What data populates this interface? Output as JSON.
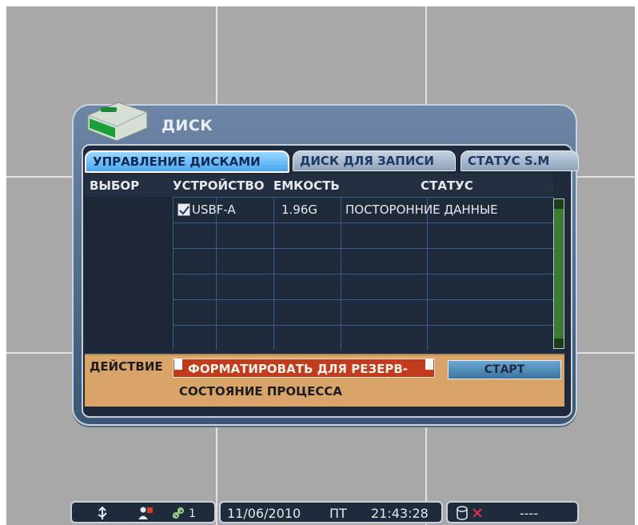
{
  "dialog": {
    "title": "ДИСК"
  },
  "tabs": [
    {
      "label": "УПРАВЛЕНИЕ ДИСКАМИ",
      "active": true
    },
    {
      "label": "ДИСК ДЛЯ ЗАПИСИ",
      "active": false
    },
    {
      "label": "СТАТУС  S.M",
      "active": false
    }
  ],
  "table": {
    "headers": [
      "ВЫБОР",
      "УСТРОЙСТВО",
      "ЕМКОСТЬ",
      "СТАТУС"
    ],
    "rows": [
      {
        "checked": true,
        "device": "USBF-A",
        "capacity": "1.96G",
        "status": "ПОСТОРОННИЕ ДАННЫЕ"
      }
    ]
  },
  "action": {
    "label": "ДЕЙСТВИЕ",
    "selected": "ФОРМАТИРОВАТЬ ДЛЯ РЕЗЕРВ-",
    "start_button": "СТАРТ",
    "process_label": "СОСТОЯНИЕ ПРОЦЕССА"
  },
  "statusbar": {
    "date": "11/06/2010",
    "weekday": "ПТ",
    "time": "21:43:28",
    "channel_count": "1",
    "storage_status": "----",
    "icons": [
      "usb-icon",
      "user-icon",
      "network-icon",
      "database-icon"
    ]
  },
  "colors": {
    "accent_tab": "#4aa6ef",
    "action_bg": "#d8a468",
    "format_bg": "#c23b1c",
    "scrollbar": "#3b7b2f"
  }
}
